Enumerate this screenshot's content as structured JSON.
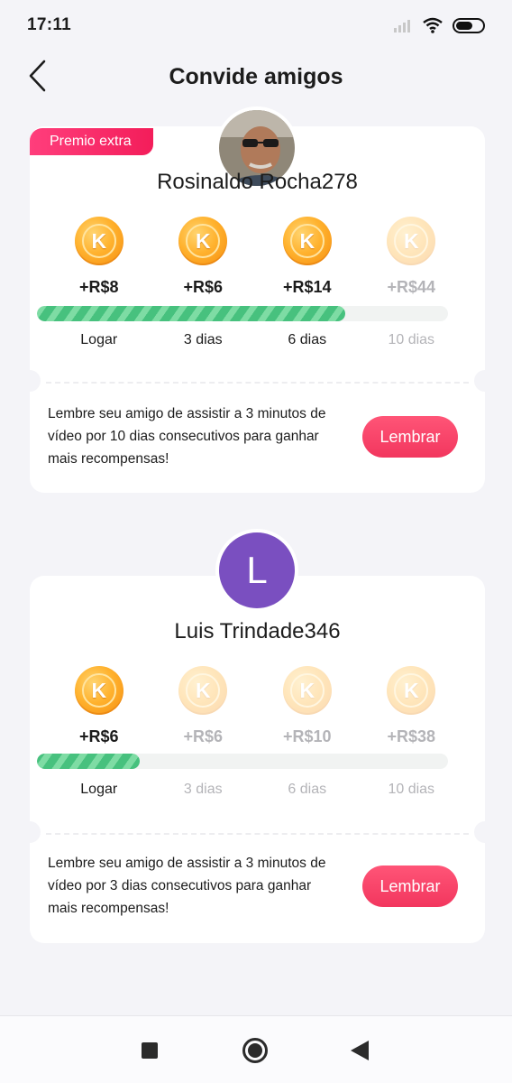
{
  "status_bar": {
    "time": "17:11"
  },
  "header": {
    "title": "Convide amigos"
  },
  "friends": [
    {
      "badge": "Premio extra",
      "name": "Rosinaldo Rocha278",
      "avatar_initial": "",
      "progress": 0.75,
      "rewards": [
        {
          "amount": "+R$8",
          "label": "Logar",
          "achieved": true
        },
        {
          "amount": "+R$6",
          "label": "3 dias",
          "achieved": true
        },
        {
          "amount": "+R$14",
          "label": "6 dias",
          "achieved": true
        },
        {
          "amount": "+R$44",
          "label": "10 dias",
          "achieved": false
        }
      ],
      "message": "Lembre seu amigo de assistir a 3 minutos de vídeo por 10 dias consecutivos para ganhar mais recompensas!",
      "button": "Lembrar"
    },
    {
      "badge": "",
      "name": "Luis Trindade346",
      "avatar_initial": "L",
      "progress": 0.25,
      "rewards": [
        {
          "amount": "+R$6",
          "label": "Logar",
          "achieved": true
        },
        {
          "amount": "+R$6",
          "label": "3 dias",
          "achieved": false
        },
        {
          "amount": "+R$10",
          "label": "6 dias",
          "achieved": false
        },
        {
          "amount": "+R$38",
          "label": "10 dias",
          "achieved": false
        }
      ],
      "message": "Lembre seu amigo de assistir a 3 minutos de vídeo por 3 dias consecutivos para ganhar mais recompensas!",
      "button": "Lembrar"
    }
  ],
  "coin_letter": "K",
  "colors": {
    "accent": "#f2365e",
    "progress": "#47c17e",
    "coin": "#ffb22e",
    "avatar_bg": "#7a4fc0"
  },
  "icons": {
    "back": "chevron-left-icon",
    "signal": "signal-icon",
    "wifi": "wifi-icon",
    "battery": "battery-icon"
  }
}
